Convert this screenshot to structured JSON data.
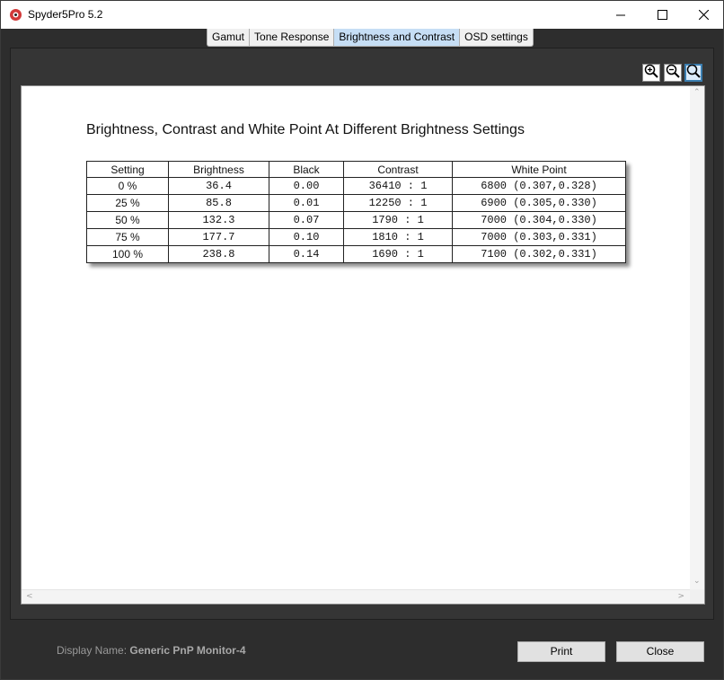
{
  "window": {
    "title": "Spyder5Pro 5.2",
    "controls": {
      "minimize": "minimize-icon",
      "maximize": "maximize-icon",
      "close": "close-icon"
    }
  },
  "tabs": [
    {
      "label": "Gamut",
      "active": false
    },
    {
      "label": "Tone Response",
      "active": false
    },
    {
      "label": "Brightness and Contrast",
      "active": true
    },
    {
      "label": "OSD settings",
      "active": false
    }
  ],
  "zoom": {
    "zoom_in": "zoom-in-icon",
    "zoom_out": "zoom-out-icon",
    "zoom_fit": "zoom-fit-icon"
  },
  "report": {
    "title": "Brightness, Contrast and White Point At Different Brightness Settings",
    "columns": [
      "Setting",
      "Brightness",
      "Black",
      "Contrast",
      "White Point"
    ],
    "rows": [
      [
        "0 %",
        "36.4",
        "0.00",
        "36410 : 1",
        "6800 (0.307,0.328)"
      ],
      [
        "25 %",
        "85.8",
        "0.01",
        "12250 : 1",
        "6900 (0.305,0.330)"
      ],
      [
        "50 %",
        "132.3",
        "0.07",
        "1790 : 1",
        "7000 (0.304,0.330)"
      ],
      [
        "75 %",
        "177.7",
        "0.10",
        "1810 : 1",
        "7000 (0.303,0.331)"
      ],
      [
        "100 %",
        "238.8",
        "0.14",
        "1690 : 1",
        "7100 (0.302,0.331)"
      ]
    ]
  },
  "footer": {
    "display_name_label": "Display Name:",
    "display_name_value": "Generic PnP Monitor-4",
    "print_label": "Print",
    "close_label": "Close"
  },
  "colors": {
    "active_tab": "#c6def5",
    "background": "#2d2d2d",
    "paper": "#ffffff"
  }
}
